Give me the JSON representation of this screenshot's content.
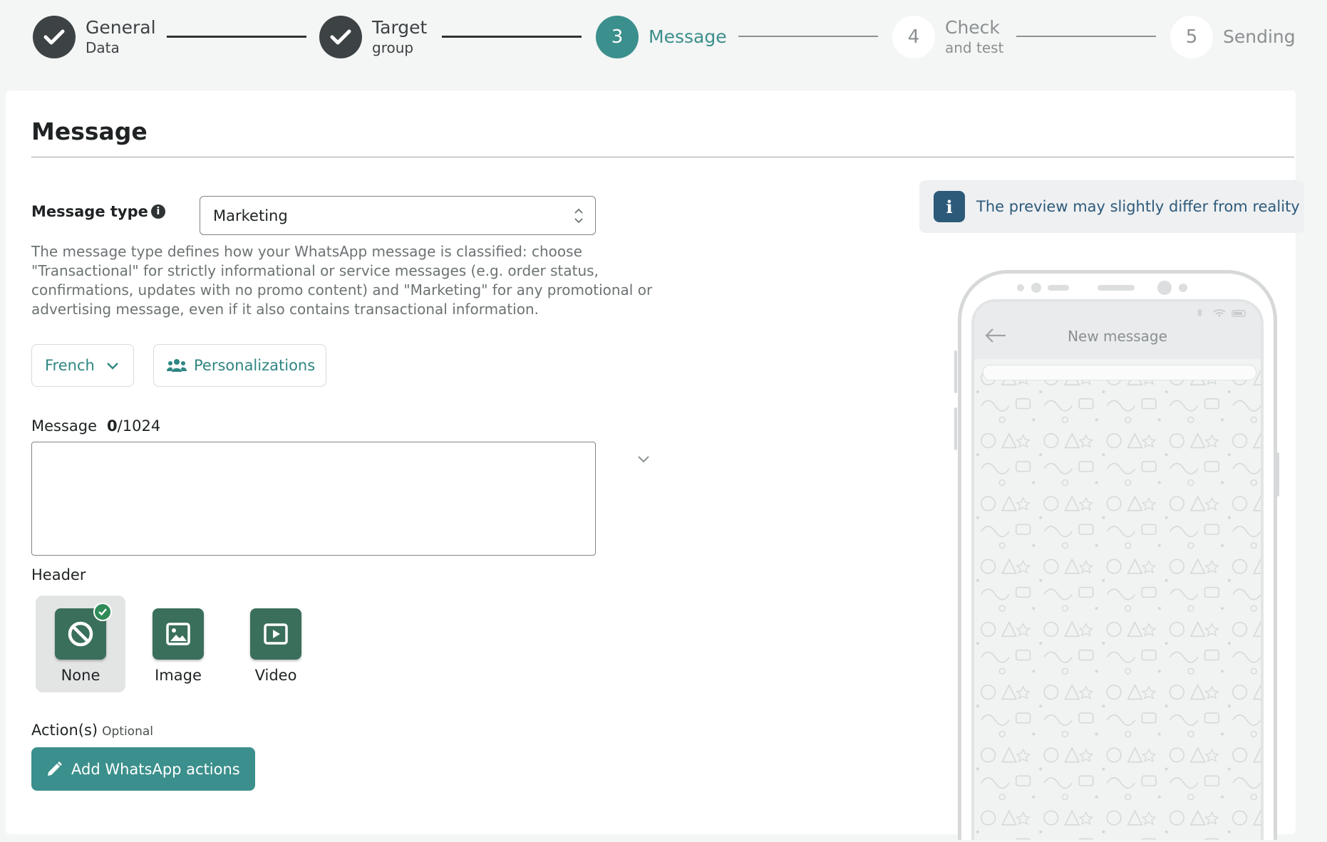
{
  "stepper": {
    "steps": [
      {
        "num": "",
        "title": "General",
        "sub": "Data",
        "state": "done"
      },
      {
        "num": "",
        "title": "Target",
        "sub": "group",
        "state": "done"
      },
      {
        "num": "3",
        "title": "Message",
        "sub": "",
        "state": "active"
      },
      {
        "num": "4",
        "title": "Check",
        "sub": "and test",
        "state": "todo"
      },
      {
        "num": "5",
        "title": "Sending",
        "sub": "",
        "state": "todo"
      }
    ]
  },
  "card": {
    "title": "Message",
    "message_type": {
      "label": "Message type",
      "info_icon": "info-icon",
      "value": "Marketing",
      "help": "The message type defines how your WhatsApp message is classified: choose \"Transactional\" for strictly informational or service messages (e.g. order status, confirmations, updates with no promo content) and \"Marketing\" for any promotional or advertising message, even if it also contains transactional information."
    },
    "language": {
      "label": "French",
      "icon": "chevron-down-icon"
    },
    "personalizations": {
      "label": "Personalizations",
      "icon": "users-icon"
    },
    "message": {
      "label": "Message",
      "count": "0",
      "max": "/1024",
      "value": ""
    },
    "header": {
      "label": "Header",
      "options": [
        {
          "label": "None",
          "icon": "ban-icon",
          "selected": true
        },
        {
          "label": "Image",
          "icon": "image-icon",
          "selected": false
        },
        {
          "label": "Video",
          "icon": "video-icon",
          "selected": false
        }
      ]
    },
    "actions": {
      "label": "Action(s)",
      "optional": "Optional",
      "button": "Add WhatsApp actions",
      "icon": "pencil-icon"
    }
  },
  "preview": {
    "notice": "The preview may slightly differ from reality",
    "notice_icon": "info-icon",
    "phone_title": "New message"
  },
  "colors": {
    "accent": "#3b8f8c",
    "done_step": "#3d4244",
    "media_tile": "#3a6f5b",
    "notice_text": "#2e5a7a",
    "selected_badge": "#2e8b57"
  }
}
